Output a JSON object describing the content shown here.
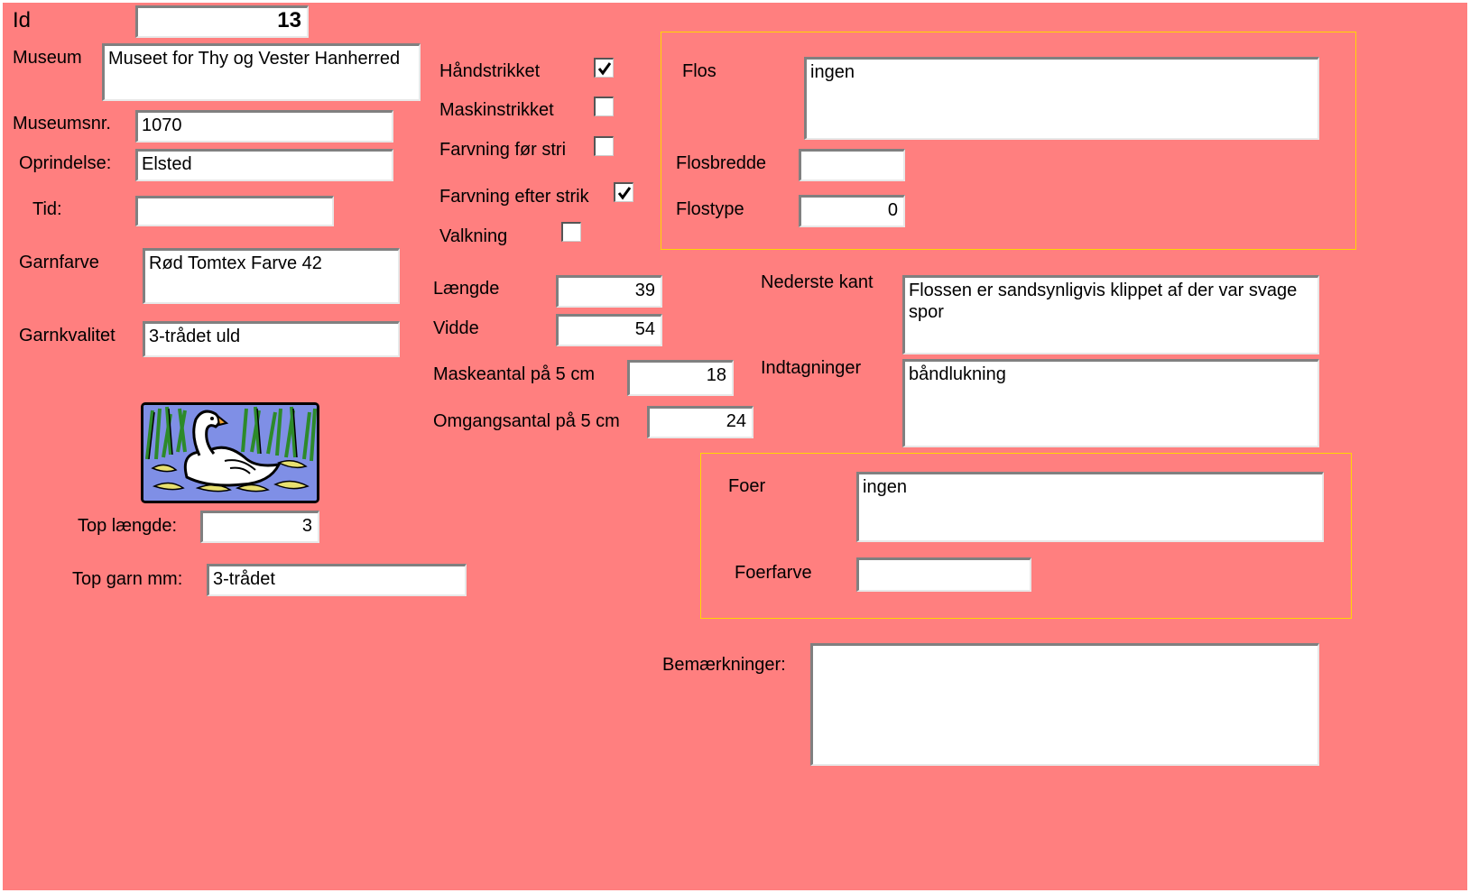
{
  "record": {
    "id_label": "Id",
    "id_value": "13",
    "museum_label": "Museum",
    "museum_value": "Museet for Thy og Vester Hanherred",
    "museumsnr_label": "Museumsnr.",
    "museumsnr_value": "1070",
    "oprindelse_label": "Oprindelse:",
    "oprindelse_value": "Elsted",
    "tid_label": "Tid:",
    "tid_value": "",
    "garnfarve_label": "Garnfarve",
    "garnfarve_value": "Rød Tomtex Farve 42",
    "garnkvalitet_label": "Garnkvalitet",
    "garnkvalitet_value": "3-trådet uld",
    "top_laengde_label": "Top længde:",
    "top_laengde_value": "3",
    "top_garn_label": "Top garn mm:",
    "top_garn_value": "3-trådet"
  },
  "checkboxes": [
    {
      "label": "Håndstrikket",
      "checked": true
    },
    {
      "label": "Maskinstrikket",
      "checked": false
    },
    {
      "label": "Farvning før stri",
      "checked": false
    },
    {
      "label": "Farvning efter strik",
      "checked": true
    },
    {
      "label": "Valkning",
      "checked": false
    }
  ],
  "measures": {
    "laengde_label": "Længde",
    "laengde_value": "39",
    "vidde_label": "Vidde",
    "vidde_value": "54",
    "maskeantal_label": "Maskeantal på 5 cm",
    "maskeantal_value": "18",
    "omgangsantal_label": "Omgangsantal på 5 cm",
    "omgangsantal_value": "24"
  },
  "flos": {
    "flos_label": "Flos",
    "flos_value": "ingen",
    "flosbredde_label": "Flosbredde",
    "flosbredde_value": "",
    "flostype_label": "Flostype",
    "flostype_value": "0"
  },
  "edges": {
    "nederste_kant_label": "Nederste kant",
    "nederste_kant_value": "Flossen er sandsynligvis klippet af der var svage spor",
    "indtagninger_label": "Indtagninger",
    "indtagninger_value": "båndlukning"
  },
  "foer": {
    "foer_label": "Foer",
    "foer_value": "ingen",
    "foerfarve_label": "Foerfarve",
    "foerfarve_value": ""
  },
  "remarks": {
    "label": "Bemærkninger:",
    "value": ""
  },
  "image": {
    "icon": "swan-icon"
  },
  "colors": {
    "background": "#ff7f7f",
    "group_border": "#ffd700"
  }
}
